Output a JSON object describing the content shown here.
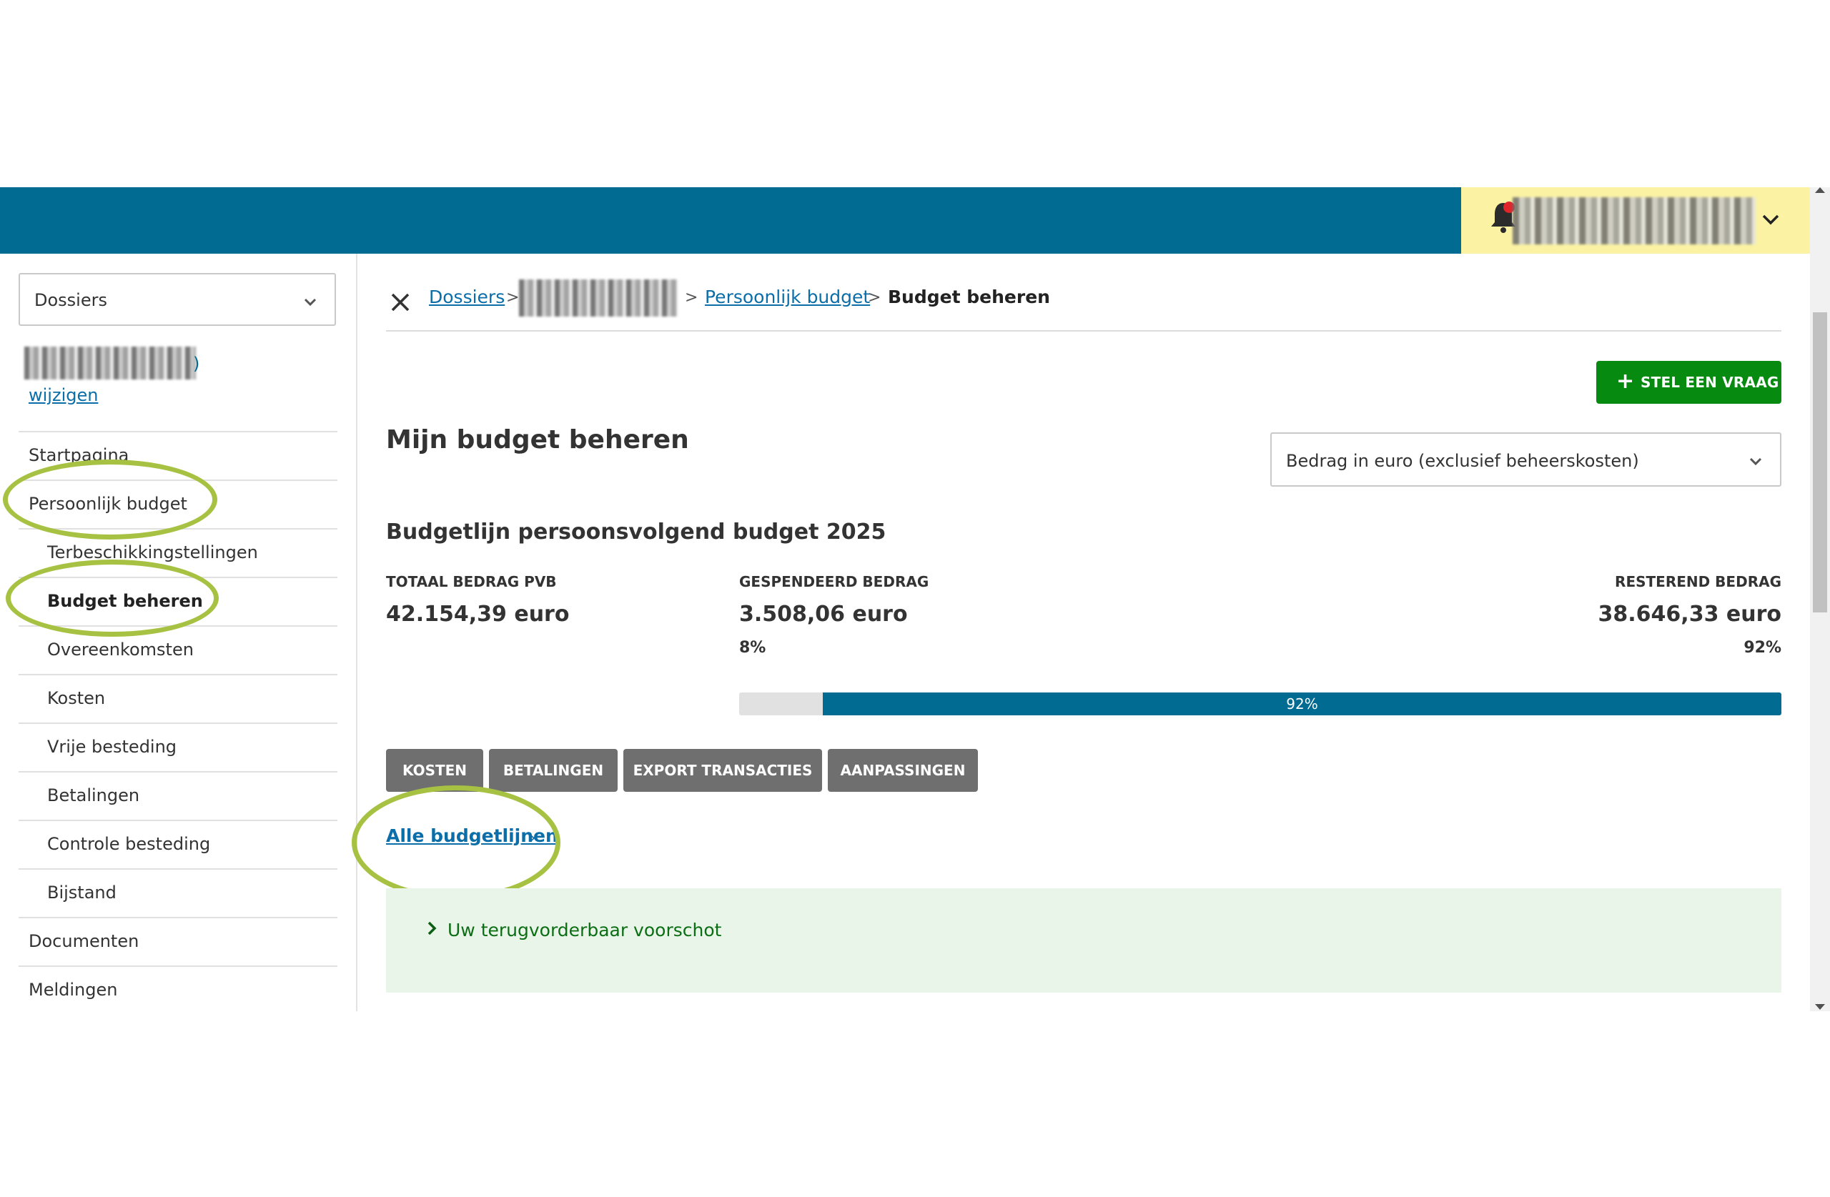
{
  "header": {
    "notification_icon": "bell-icon",
    "account_chevron_icon": "chevron-down-icon"
  },
  "sidebar": {
    "dossier_select": {
      "selected": "Dossiers"
    },
    "client_name_suffix": ")",
    "change_link": "wijzigen",
    "items": [
      {
        "label": "Startpagina",
        "level": 1,
        "active": false
      },
      {
        "label": "Persoonlijk budget",
        "level": 1,
        "active": false,
        "highlighted": true
      },
      {
        "label": "Terbeschikkingstellingen",
        "level": 2,
        "active": false
      },
      {
        "label": "Budget beheren",
        "level": 2,
        "active": true,
        "highlighted": true
      },
      {
        "label": "Overeenkomsten",
        "level": 2,
        "active": false
      },
      {
        "label": "Kosten",
        "level": 2,
        "active": false
      },
      {
        "label": "Vrije besteding",
        "level": 2,
        "active": false
      },
      {
        "label": "Betalingen",
        "level": 2,
        "active": false
      },
      {
        "label": "Controle besteding",
        "level": 2,
        "active": false
      },
      {
        "label": "Bijstand",
        "level": 2,
        "active": false
      },
      {
        "label": "Documenten",
        "level": 1,
        "active": false
      },
      {
        "label": "Meldingen",
        "level": 1,
        "active": false
      }
    ]
  },
  "breadcrumb": {
    "items": [
      {
        "label": "Dossiers",
        "link": true
      },
      {
        "label": "Persoonlijk budget",
        "link": true
      },
      {
        "label": "Budget beheren",
        "link": false
      }
    ],
    "separator": ">"
  },
  "main": {
    "ask_button": "STEL EEN VRAAG",
    "title": "Mijn budget beheren",
    "amount_select": "Bedrag in euro (exclusief beheerskosten)",
    "budget_line_title": "Budgetlijn persoonsvolgend budget 2025",
    "stats": {
      "total": {
        "label": "TOTAAL BEDRAG PVB",
        "value": "42.154,39 euro"
      },
      "spent": {
        "label": "GESPENDEERD BEDRAG",
        "value": "3.508,06 euro",
        "percent": "8%"
      },
      "remaining": {
        "label": "RESTEREND BEDRAG",
        "value": "38.646,33 euro",
        "percent": "92%"
      }
    },
    "progress": {
      "remaining_fraction": 0.92,
      "label": "92%"
    },
    "tabs": [
      "KOSTEN",
      "BETALINGEN",
      "EXPORT TRANSACTIES",
      "AANPASSINGEN"
    ],
    "all_lines_link": "Alle budgetlijnen",
    "all_lines_chevron": "›",
    "advance_panel_label": "Uw terugvorderbaar voorschot"
  },
  "colors": {
    "header_blue": "#016b92",
    "user_box_yellow": "#fbf3a3",
    "primary_green": "#078a10",
    "link_blue": "#0b6ea8",
    "tab_gray": "#6f6f6f",
    "highlight_ring": "#a7c242",
    "panel_green": "#e9f5e9"
  }
}
